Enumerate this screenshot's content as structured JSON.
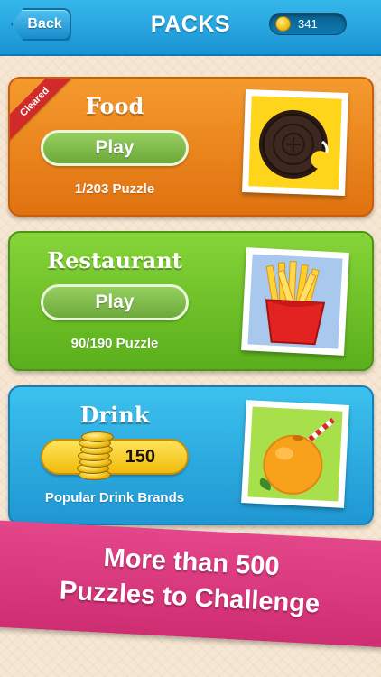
{
  "header": {
    "back_label": "Back",
    "title": "PACKS",
    "coins": "341",
    "coin_icon": "coin-icon"
  },
  "packs": [
    {
      "title": "Food",
      "button_label": "Play",
      "progress": "1/203 Puzzle",
      "ribbon": "Cleared",
      "image": "oreo-cookie-icon",
      "color": "#f08a24"
    },
    {
      "title": "Restaurant",
      "button_label": "Play",
      "progress": "90/190 Puzzle",
      "image": "french-fries-icon",
      "color": "#74c22a"
    },
    {
      "title": "Drink",
      "price": "150",
      "subtitle": "Popular Drink Brands",
      "image": "orange-drink-icon",
      "color": "#2aa9e0"
    }
  ],
  "banner": {
    "line1": "More than 500",
    "line2": "Puzzles to Challenge",
    "color": "#d93679"
  }
}
